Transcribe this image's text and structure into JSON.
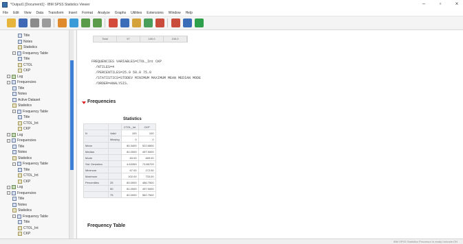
{
  "titlebar": {
    "title": "*Output1 [Document1] - IBM SPSS Statistics Viewer",
    "minimize": "–",
    "maximize": "▫",
    "close": "×"
  },
  "menus": [
    "File",
    "Edit",
    "View",
    "Data",
    "Transform",
    "Insert",
    "Format",
    "Analyze",
    "Graphs",
    "Utilities",
    "Extensions",
    "Window",
    "Help"
  ],
  "toolbar": {
    "buttons": [
      {
        "name": "open-file-button",
        "color": "#e7b53b"
      },
      {
        "name": "save-button",
        "color": "#3f69b4"
      },
      {
        "name": "print-button",
        "color": "#8a8a8a"
      },
      {
        "name": "print-preview-button",
        "color": "#9b9b9b"
      },
      {
        "name": "export-button",
        "color": "#e08a2e"
      },
      {
        "name": "recall-dialog-button",
        "color": "#3b9bd8"
      },
      {
        "name": "undo-button",
        "color": "#5a9b4a"
      },
      {
        "name": "redo-button",
        "color": "#5a9b4a"
      },
      {
        "name": "goto-data-button",
        "color": "#d44b3b"
      },
      {
        "name": "goto-case-button",
        "color": "#3b6cb7"
      },
      {
        "name": "variables-button",
        "color": "#d4a23b"
      },
      {
        "name": "chart-button",
        "color": "#4a9e5c"
      },
      {
        "name": "designate-window-button",
        "color": "#c84b3b"
      },
      {
        "name": "insert-heading-button",
        "color": "#c84b3b"
      },
      {
        "name": "insert-title-button",
        "color": "#3b6cb7"
      },
      {
        "name": "insert-text-button",
        "color": "#2e9f4a"
      }
    ]
  },
  "tree": [
    {
      "label": "Title",
      "depth": 3,
      "type": "item"
    },
    {
      "label": "Notes",
      "depth": 3,
      "type": "item"
    },
    {
      "label": "Statistics",
      "depth": 3,
      "type": "table"
    },
    {
      "label": "Frequency Table",
      "depth": 2,
      "type": "folder"
    },
    {
      "label": "Title",
      "depth": 3,
      "type": "item"
    },
    {
      "label": "CTOL",
      "depth": 3,
      "type": "table"
    },
    {
      "label": "CKP",
      "depth": 3,
      "type": "table"
    },
    {
      "label": "Log",
      "depth": 1,
      "type": "log"
    },
    {
      "label": "Frequencies",
      "depth": 1,
      "type": "folder"
    },
    {
      "label": "Title",
      "depth": 2,
      "type": "item"
    },
    {
      "label": "Notes",
      "depth": 2,
      "type": "item"
    },
    {
      "label": "Active Dataset",
      "depth": 2,
      "type": "item"
    },
    {
      "label": "Statistics",
      "depth": 2,
      "type": "table"
    },
    {
      "label": "Frequency Table",
      "depth": 2,
      "type": "folder"
    },
    {
      "label": "Title",
      "depth": 3,
      "type": "item"
    },
    {
      "label": "CTOL_Int",
      "depth": 3,
      "type": "table"
    },
    {
      "label": "CKP",
      "depth": 3,
      "type": "table"
    },
    {
      "label": "Log",
      "depth": 1,
      "type": "log"
    },
    {
      "label": "Frequencies",
      "depth": 1,
      "type": "folder"
    },
    {
      "label": "Title",
      "depth": 2,
      "type": "item"
    },
    {
      "label": "Notes",
      "depth": 2,
      "type": "item"
    },
    {
      "label": "Statistics",
      "depth": 2,
      "type": "table"
    },
    {
      "label": "Frequency Table",
      "depth": 2,
      "type": "folder"
    },
    {
      "label": "Title",
      "depth": 3,
      "type": "item"
    },
    {
      "label": "CTOL_Int",
      "depth": 3,
      "type": "table"
    },
    {
      "label": "CKP",
      "depth": 3,
      "type": "table"
    },
    {
      "label": "Log",
      "depth": 1,
      "type": "log"
    },
    {
      "label": "Frequencies",
      "depth": 1,
      "type": "folder"
    },
    {
      "label": "Title",
      "depth": 2,
      "type": "item"
    },
    {
      "label": "Notes",
      "depth": 2,
      "type": "item"
    },
    {
      "label": "Statistics",
      "depth": 2,
      "type": "table"
    },
    {
      "label": "Frequency Table",
      "depth": 2,
      "type": "folder"
    },
    {
      "label": "Title",
      "depth": 3,
      "type": "item"
    },
    {
      "label": "CTOL_Int",
      "depth": 3,
      "type": "table"
    },
    {
      "label": "CKP",
      "depth": 3,
      "type": "table"
    }
  ],
  "mini_table": [
    "Total",
    "97",
    "100.0",
    "100.0"
  ],
  "syntax_lines": [
    "FREQUENCIES VARIABLES=CTOL_Int CKP",
    "  /NTILES=4",
    "  /PERCENTILES=25.0 50.0 75.0",
    "  /STATISTICS=STDDEV MINIMUM MAXIMUM MEAN MEDIAN MODE",
    "  /ORDER=ANALYSIS."
  ],
  "frequencies_title": "Frequencies",
  "statistics": {
    "title": "Statistics",
    "columns": [
      "",
      "",
      "CTOL_Int",
      "CKP"
    ],
    "rows": [
      [
        "N",
        "Valid",
        "100",
        "100"
      ],
      [
        "",
        "Missing",
        "0",
        "0"
      ],
      [
        "Mean",
        "",
        "80.3400",
        "522.6800"
      ],
      [
        "Median",
        "",
        "81.0000",
        "497.5000"
      ],
      [
        "Mode",
        "",
        "83.00",
        "489.00"
      ],
      [
        "Std. Deviation",
        "",
        "4.63359",
        "73.86709"
      ],
      [
        "Minimum",
        "",
        "67.00",
        "172.00"
      ],
      [
        "Maximum",
        "",
        "102.00",
        "733.00"
      ],
      [
        "Percentiles",
        "25",
        "80.0000",
        "486.7500"
      ],
      [
        "",
        "50",
        "81.0000",
        "497.5000"
      ],
      [
        "",
        "75",
        "82.0000",
        "562.7500"
      ]
    ]
  },
  "frequency_table_title": "Frequency Table",
  "statusbar": {
    "text": "IBM SPSS Statistics Processor is ready    Unicode:ON"
  }
}
